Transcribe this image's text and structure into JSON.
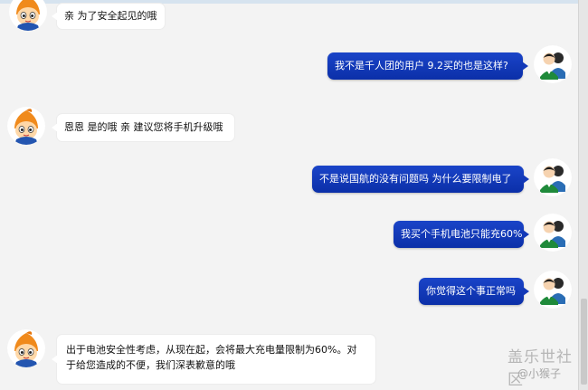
{
  "messages": [
    {
      "role": "agent",
      "text": "亲 为了安全起见的哦",
      "avatar_icon": "agent-mascot-avatar-icon"
    },
    {
      "role": "user",
      "text": "我不是千人团的用户 9.2买的也是这样?",
      "avatar_icon": "user-avatar-icon"
    },
    {
      "role": "agent",
      "text": "恩恩 是的哦 亲 建议您将手机升级哦",
      "avatar_icon": "agent-mascot-avatar-icon"
    },
    {
      "role": "user",
      "text": "不是说国航的没有问题吗 为什么要限制电了",
      "avatar_icon": "user-avatar-icon"
    },
    {
      "role": "user",
      "text": "我买个手机电池只能充60%",
      "avatar_icon": "user-avatar-icon"
    },
    {
      "role": "user",
      "text": "你觉得这个事正常吗",
      "avatar_icon": "user-avatar-icon"
    },
    {
      "role": "agent",
      "text": "出于电池安全性考虑，从现在起，会将最大充电量限制为60%。对于给您造成的不便，我们深表歉意的哦",
      "avatar_icon": "agent-mascot-avatar-icon"
    }
  ],
  "watermark": {
    "logo_text": "盖乐世社区",
    "username": "@小猴子"
  },
  "colors": {
    "user_bubble": "#1339b8",
    "agent_bubble": "#ffffff",
    "background": "#f3f3f3"
  }
}
